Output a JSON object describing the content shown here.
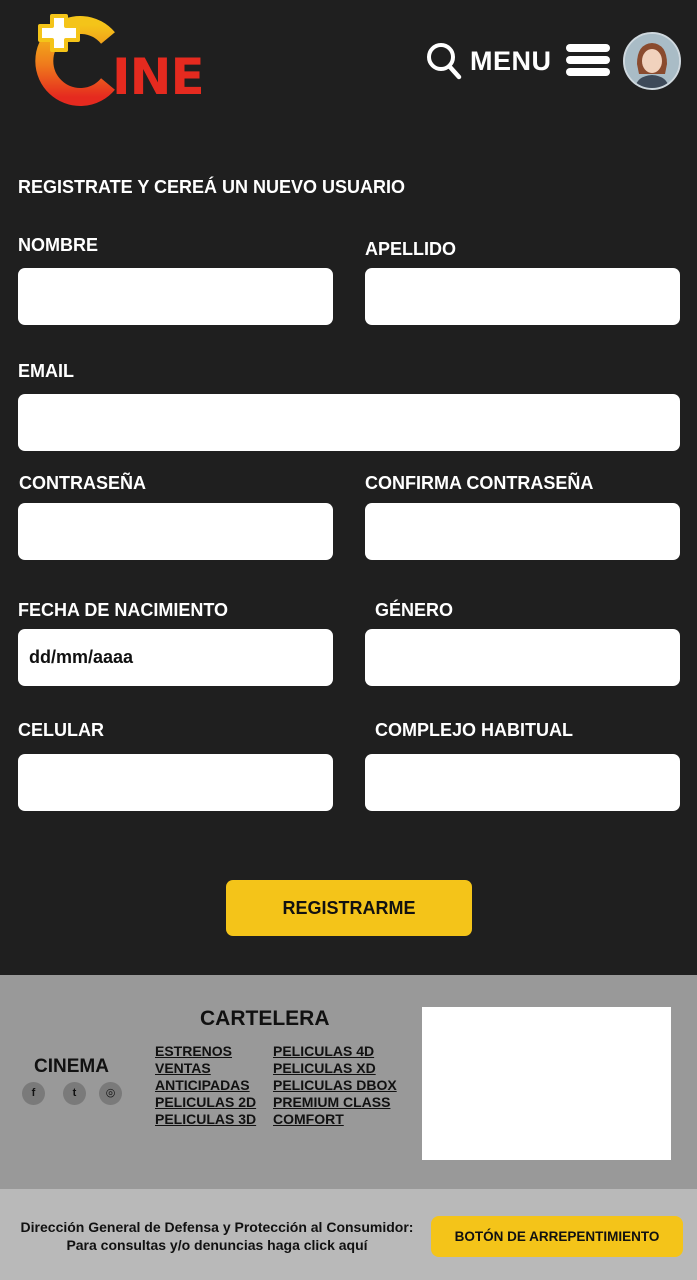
{
  "header": {
    "logo_text": "INE",
    "menu_label": "MENU"
  },
  "form": {
    "title": "REGISTRATE Y CEREÁ UN NUEVO USUARIO",
    "nombre_label": "NOMBRE",
    "nombre_value": "",
    "apellido_label": "APELLIDO",
    "apellido_value": "",
    "email_label": "EMAIL",
    "email_value": "",
    "password_label": "CONTRASEÑA",
    "password_value": "",
    "confirm_password_label": "CONFIRMA CONTRASEÑA",
    "confirm_password_value": "",
    "birthdate_label": "FECHA DE NACIMIENTO",
    "birthdate_value": "dd/mm/aaaa",
    "gender_label": "GÉNERO",
    "gender_value": "",
    "phone_label": "CELULAR",
    "phone_value": "",
    "complex_label": "COMPLEJO HABITUAL",
    "complex_value": "",
    "submit_label": "REGISTRARME"
  },
  "footer": {
    "brand": "CINEMA",
    "social_icons": [
      "facebook-icon",
      "twitter-icon",
      "instagram-icon"
    ],
    "social_glyphs": [
      "f",
      "t",
      "◎"
    ],
    "cartelera_title": "CARTELERA",
    "links_left": [
      "ESTRENOS",
      "VENTAS",
      "ANTICIPADAS",
      "PELICULAS 2D",
      "PELICULAS 3D"
    ],
    "links_right": [
      "PELICULAS 4D",
      "PELICULAS XD",
      "PELICULAS DBOX",
      "PREMIUM CLASS",
      "COMFORT"
    ],
    "consumer_line1": "Dirección General de Defensa y Protección al Consumidor:",
    "consumer_line2": "Para consultas y/o denuncias haga click aquí",
    "arrepentimiento_label": "BOTÓN DE ARREPENTIMIENTO"
  },
  "colors": {
    "background": "#1f1f1f",
    "accent_yellow": "#f4c419",
    "logo_red": "#e52a1f",
    "footer_gray": "#999999",
    "footer_bottom_gray": "#b9b9b9"
  }
}
